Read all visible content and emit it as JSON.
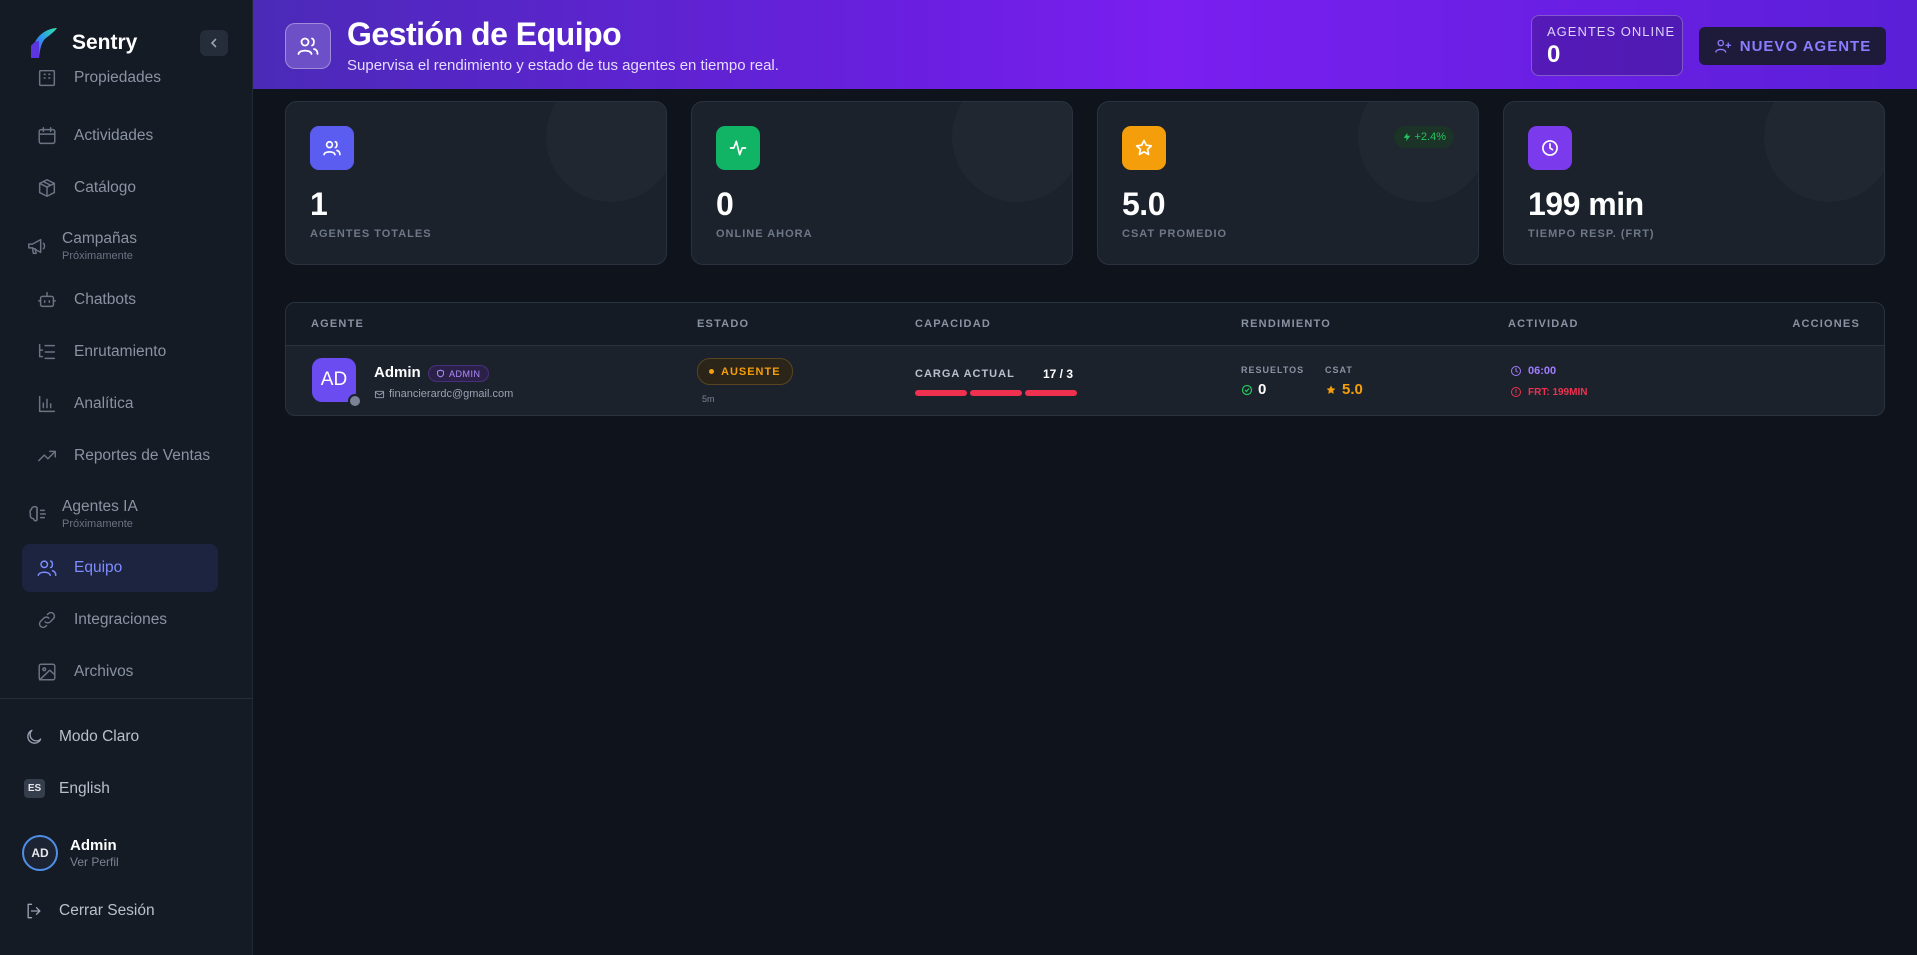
{
  "sidebar": {
    "brand": "Sentry",
    "items": [
      {
        "label": "Propiedades"
      },
      {
        "label": "Actividades"
      },
      {
        "label": "Catálogo"
      },
      {
        "label": "Campañas",
        "sub": "Próximamente"
      },
      {
        "label": "Chatbots"
      },
      {
        "label": "Enrutamiento"
      },
      {
        "label": "Analítica"
      },
      {
        "label": "Reportes de Ventas"
      },
      {
        "label": "Agentes IA",
        "sub": "Próximamente"
      },
      {
        "label": "Equipo"
      },
      {
        "label": "Integraciones"
      },
      {
        "label": "Archivos"
      }
    ],
    "theme_toggle": "Modo Claro",
    "language_badge": "ES",
    "language": "English",
    "user": {
      "initials": "AD",
      "name": "Admin",
      "sub": "Ver Perfil"
    },
    "logout": "Cerrar Sesión"
  },
  "header": {
    "title": "Gestión de Equipo",
    "subtitle": "Supervisa el rendimiento y estado de tus agentes en tiempo real.",
    "online_label": "AGENTES ONLINE",
    "online_value": "0",
    "new_agent_button": "NUEVO AGENTE"
  },
  "stats": [
    {
      "value": "1",
      "label": "AGENTES TOTALES",
      "color": "#5b5cf0"
    },
    {
      "value": "0",
      "label": "ONLINE AHORA",
      "color": "#10b464"
    },
    {
      "value": "5.0",
      "label": "CSAT PROMEDIO",
      "color": "#f59e0b",
      "trend": "+2.4%"
    },
    {
      "value": "199 min",
      "label": "TIEMPO RESP. (FRT)",
      "color": "#7c3aed"
    }
  ],
  "table": {
    "headers": [
      "AGENTE",
      "ESTADO",
      "CAPACIDAD",
      "RENDIMIENTO",
      "ACTIVIDAD",
      "ACCIONES"
    ],
    "rows": [
      {
        "initials": "AD",
        "name": "Admin",
        "role": "ADMIN",
        "email": "financierardc@gmail.com",
        "status": "AUSENTE",
        "status_time": "5m",
        "capacity_label": "CARGA ACTUAL",
        "capacity_value": "17 / 3",
        "capacity_load": 1.0,
        "results_label": "RESUELTOS",
        "results_value": "0",
        "csat_label": "CSAT",
        "csat_value": "5.0",
        "activity_time": "06:00",
        "activity_frt": "FRT: 199MIN"
      }
    ]
  },
  "colors": {
    "accent": "#7f8cff",
    "header_gradient": "#6a1fe0",
    "away": "#f59e0b",
    "danger": "#f0304f",
    "success": "#22c55e"
  }
}
